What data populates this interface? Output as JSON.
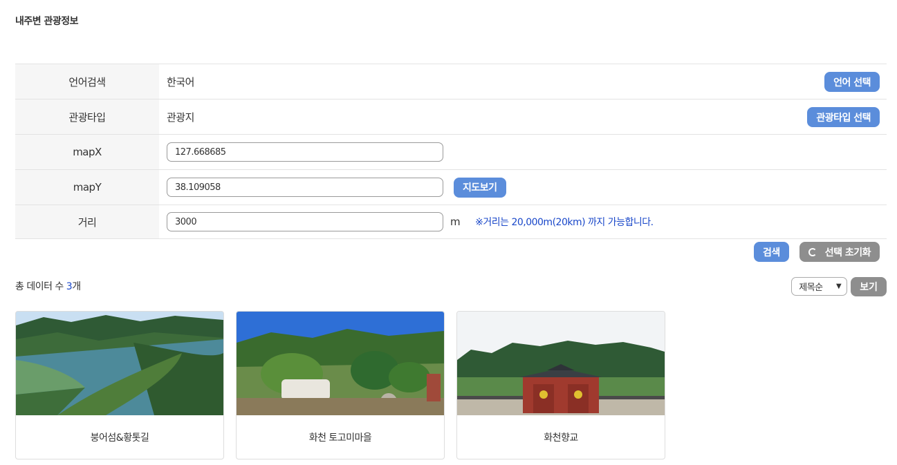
{
  "page": {
    "title": "내주변 관광정보"
  },
  "form": {
    "language": {
      "label": "언어검색",
      "value": "한국어",
      "button": "언어 선택"
    },
    "tourType": {
      "label": "관광타입",
      "value": "관광지",
      "button": "관광타입 선택"
    },
    "mapX": {
      "label": "mapX",
      "value": "127.668685"
    },
    "mapY": {
      "label": "mapY",
      "value": "38.109058",
      "button": "지도보기"
    },
    "distance": {
      "label": "거리",
      "value": "3000",
      "unit": "m",
      "hint": "※거리는 20,000m(20km) 까지 가능합니다."
    }
  },
  "actions": {
    "search": "검색",
    "reset": "선택 초기화"
  },
  "results": {
    "total_prefix": "총 데이터 수 ",
    "total_count": "3",
    "total_suffix": "개",
    "sort_selected": "제목순",
    "view_button": "보기",
    "items": [
      {
        "title": "붕어섬&황톳길"
      },
      {
        "title": "화천 토고미마을"
      },
      {
        "title": "화천향교"
      }
    ]
  },
  "colors": {
    "accent": "#5b8ddb",
    "secondary": "#8e8e8e",
    "hint": "#1947c9"
  }
}
